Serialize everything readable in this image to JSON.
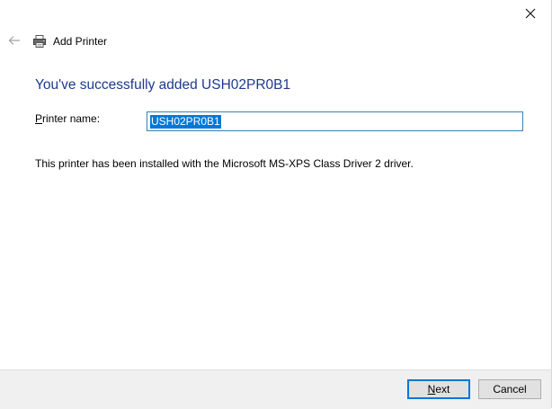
{
  "window": {
    "close_icon": "close-icon",
    "back_icon": "back-arrow-icon"
  },
  "header": {
    "icon": "printer-icon",
    "title": "Add Printer"
  },
  "main": {
    "heading": "You've successfully added USH02PR0B1",
    "printer_name_label_first": "P",
    "printer_name_label_rest": "rinter name:",
    "printer_name_value": "USH02PR0B1",
    "install_info": "This printer has been installed with the Microsoft MS-XPS Class Driver 2 driver."
  },
  "footer": {
    "next_label_first": "N",
    "next_label_rest": "ext",
    "cancel_label": "Cancel"
  },
  "colors": {
    "heading": "#1e3a8c",
    "selection": "#0078d7",
    "footer_bg": "#f0f0f0"
  }
}
